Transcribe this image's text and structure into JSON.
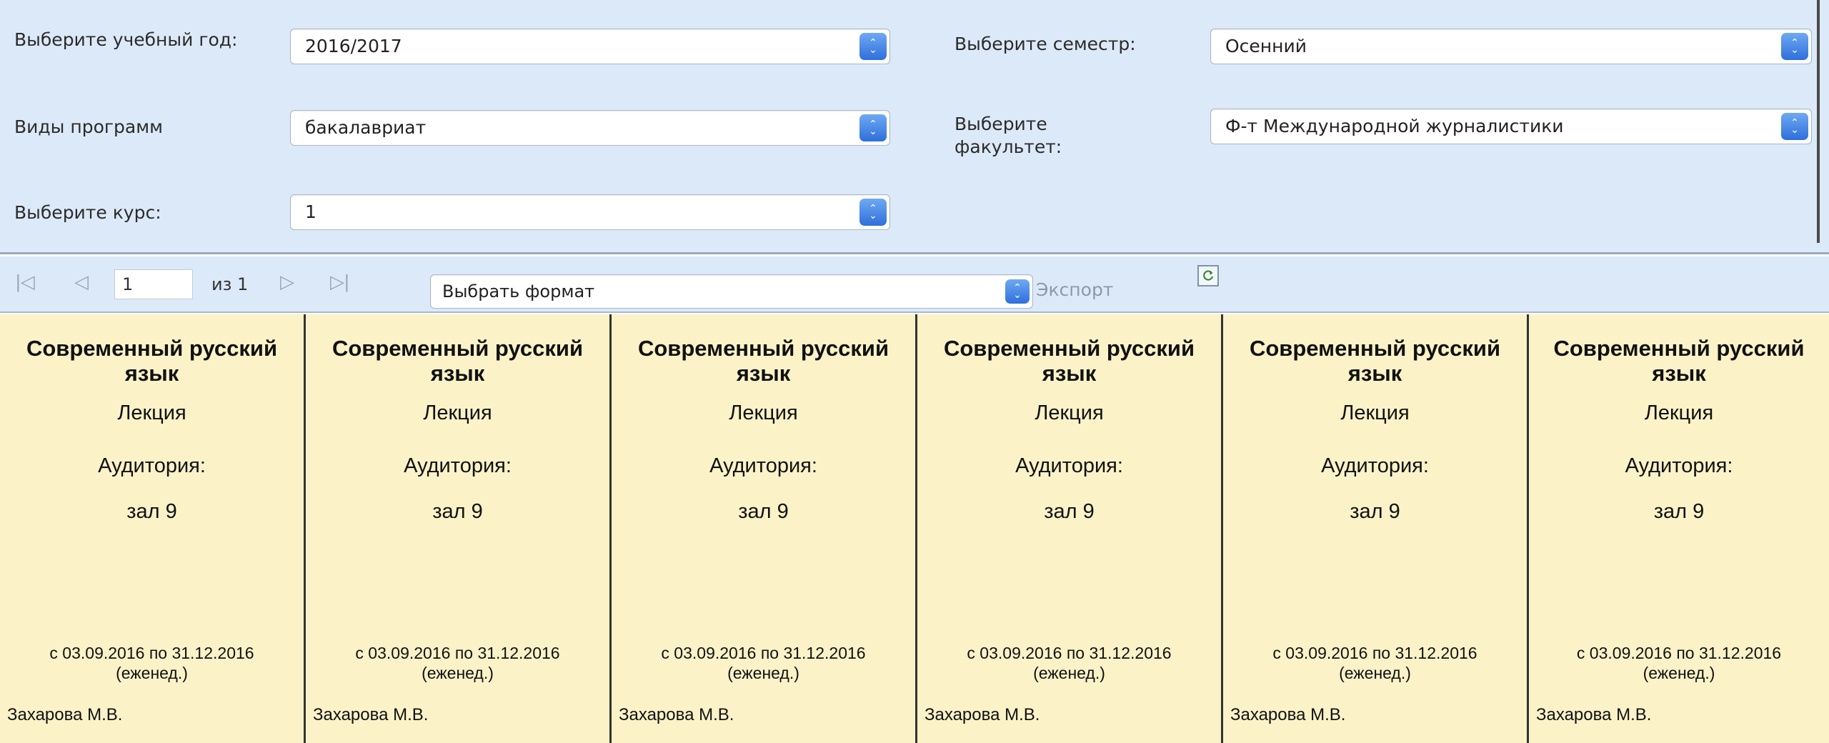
{
  "filters": {
    "year_label": "Выберите учебный год:",
    "year_value": "2016/2017",
    "semester_label": "Выберите семестр:",
    "semester_value": "Осенний",
    "program_label": "Виды программ",
    "program_value": "бакалавриат",
    "faculty_label": "Выберите факультет:",
    "faculty_value": "Ф-т Международной журналистики",
    "course_label": "Выберите курс:",
    "course_value": "1"
  },
  "toolbar": {
    "first_icon": "first-page-icon",
    "prev_icon": "prev-page-icon",
    "next_icon": "next-page-icon",
    "last_icon": "last-page-icon",
    "page_value": "1",
    "of_pages": "из 1",
    "format_value": "Выбрать формат",
    "export_label": "Экспорт",
    "refresh_icon": "refresh-icon"
  },
  "schedule": [
    {
      "title": "Современный русский язык",
      "type": "Лекция",
      "auditorium_label": "Аудитория:",
      "room": "зал 9",
      "dates": "с 03.09.2016 по 31.12.2016",
      "frequency": "(еженед.)",
      "teacher": "Захарова М.В."
    },
    {
      "title": "Современный русский язык",
      "type": "Лекция",
      "auditorium_label": "Аудитория:",
      "room": "зал 9",
      "dates": "с 03.09.2016 по 31.12.2016",
      "frequency": "(еженед.)",
      "teacher": "Захарова М.В."
    },
    {
      "title": "Современный русский язык",
      "type": "Лекция",
      "auditorium_label": "Аудитория:",
      "room": "зал 9",
      "dates": "с 03.09.2016 по 31.12.2016",
      "frequency": "(еженед.)",
      "teacher": "Захарова М.В."
    },
    {
      "title": "Современный русский язык",
      "type": "Лекция",
      "auditorium_label": "Аудитория:",
      "room": "зал 9",
      "dates": "с 03.09.2016 по 31.12.2016",
      "frequency": "(еженед.)",
      "teacher": "Захарова М.В."
    },
    {
      "title": "Современный русский язык",
      "type": "Лекция",
      "auditorium_label": "Аудитория:",
      "room": "зал 9",
      "dates": "с 03.09.2016 по 31.12.2016",
      "frequency": "(еженед.)",
      "teacher": "Захарова М.В."
    },
    {
      "title": "Современный русский язык",
      "type": "Лекция",
      "auditorium_label": "Аудитория:",
      "room": "зал 9",
      "dates": "с 03.09.2016 по 31.12.2016",
      "frequency": "(еженед.)",
      "teacher": "Захарова М.В."
    }
  ],
  "colors": {
    "panel_bg": "#dce9f8",
    "cell_bg": "#fbf2c8",
    "select_arrow": "#2e6fdb"
  }
}
